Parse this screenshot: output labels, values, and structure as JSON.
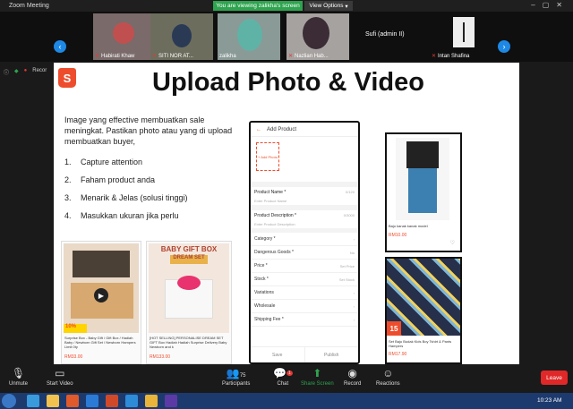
{
  "window": {
    "title": "Zoom Meeting",
    "viewing_banner": "You are viewing zalikha's screen",
    "view_options": "View Options"
  },
  "participants_strip": [
    {
      "name": "Habirati Khaw"
    },
    {
      "name": "SITI NOR AT..."
    },
    {
      "name": "zalikha"
    },
    {
      "name": "Nazlian Hab..."
    },
    {
      "name": "Sufi (admin II)"
    },
    {
      "name": "Intan Shafina"
    }
  ],
  "mini_status": {
    "record_label": "Recor"
  },
  "slide": {
    "logo_letter": "S",
    "title": "Upload Photo & Video",
    "intro": "Image yang effective membuatkan sale meningkat. Pastikan  photo atau yang di upload membuatkan buyer,",
    "bullets": [
      {
        "num": "1.",
        "text": "Capture attention"
      },
      {
        "num": "2.",
        "text": "Faham product anda"
      },
      {
        "num": "3.",
        "text": "Menarik & Jelas (solusi tinggi)"
      },
      {
        "num": "4.",
        "text": " Masukkan ukuran jika perlu"
      }
    ],
    "product1": {
      "badge": "10%",
      "caption": "Surprise Box - Baby Gift / Gift Box / Hadiah Baby / Newborn Gift Set / Newborn Hampers Limit 0ty",
      "price": "RM33.00"
    },
    "product2": {
      "banner": "BABY GIFT BOX",
      "sub": "DREAM SET",
      "caption": "[HOT SELLING] PERSONALISE DREAM SET GIFT Box Hadiah Hadiah Surprise Delivery Baby Newborn and k",
      "price": "RM133.00"
    },
    "phone": {
      "header": "Add Product",
      "add_photo": "+ Add Photo",
      "name_label": "Product Name *",
      "name_placeholder": "Enter Product Name",
      "name_counter": "0/120",
      "desc_label": "Product Description *",
      "desc_placeholder": "Enter Product Description",
      "desc_counter": "0/3000",
      "rows": [
        {
          "label": "Category *",
          "value": ""
        },
        {
          "label": "Dangerous Goods *",
          "value": "No"
        },
        {
          "label": "Price *",
          "value": "Set Price"
        },
        {
          "label": "Stock *",
          "value": "Set Stock"
        },
        {
          "label": "Variations",
          "value": ""
        },
        {
          "label": "Wholesale",
          "value": ""
        },
        {
          "label": "Shipping Fee *",
          "value": ""
        }
      ],
      "save": "Save",
      "publish": "Publish"
    },
    "card1": {
      "caption": "Baju kanak kanak model",
      "price": "RM10.00"
    },
    "card2": {
      "badge": "15",
      "caption": "Set Baju Budak Kids Boy Tshirt & Pants Hampers",
      "price": "RM17.90"
    }
  },
  "toolbar": {
    "unmute": "Unmute",
    "start_video": "Start Video",
    "participants": "Participants",
    "participants_count": "75",
    "chat": "Chat",
    "chat_badge": "1",
    "share_screen": "Share Screen",
    "record": "Record",
    "reactions": "Reactions",
    "leave": "Leave"
  },
  "taskbar": {
    "time": "10:23 AM"
  },
  "colors": {
    "shopee": "#ee4d2d",
    "leave": "#e02828",
    "share": "#2ea44f",
    "taskbar": "#1c3a6e"
  }
}
